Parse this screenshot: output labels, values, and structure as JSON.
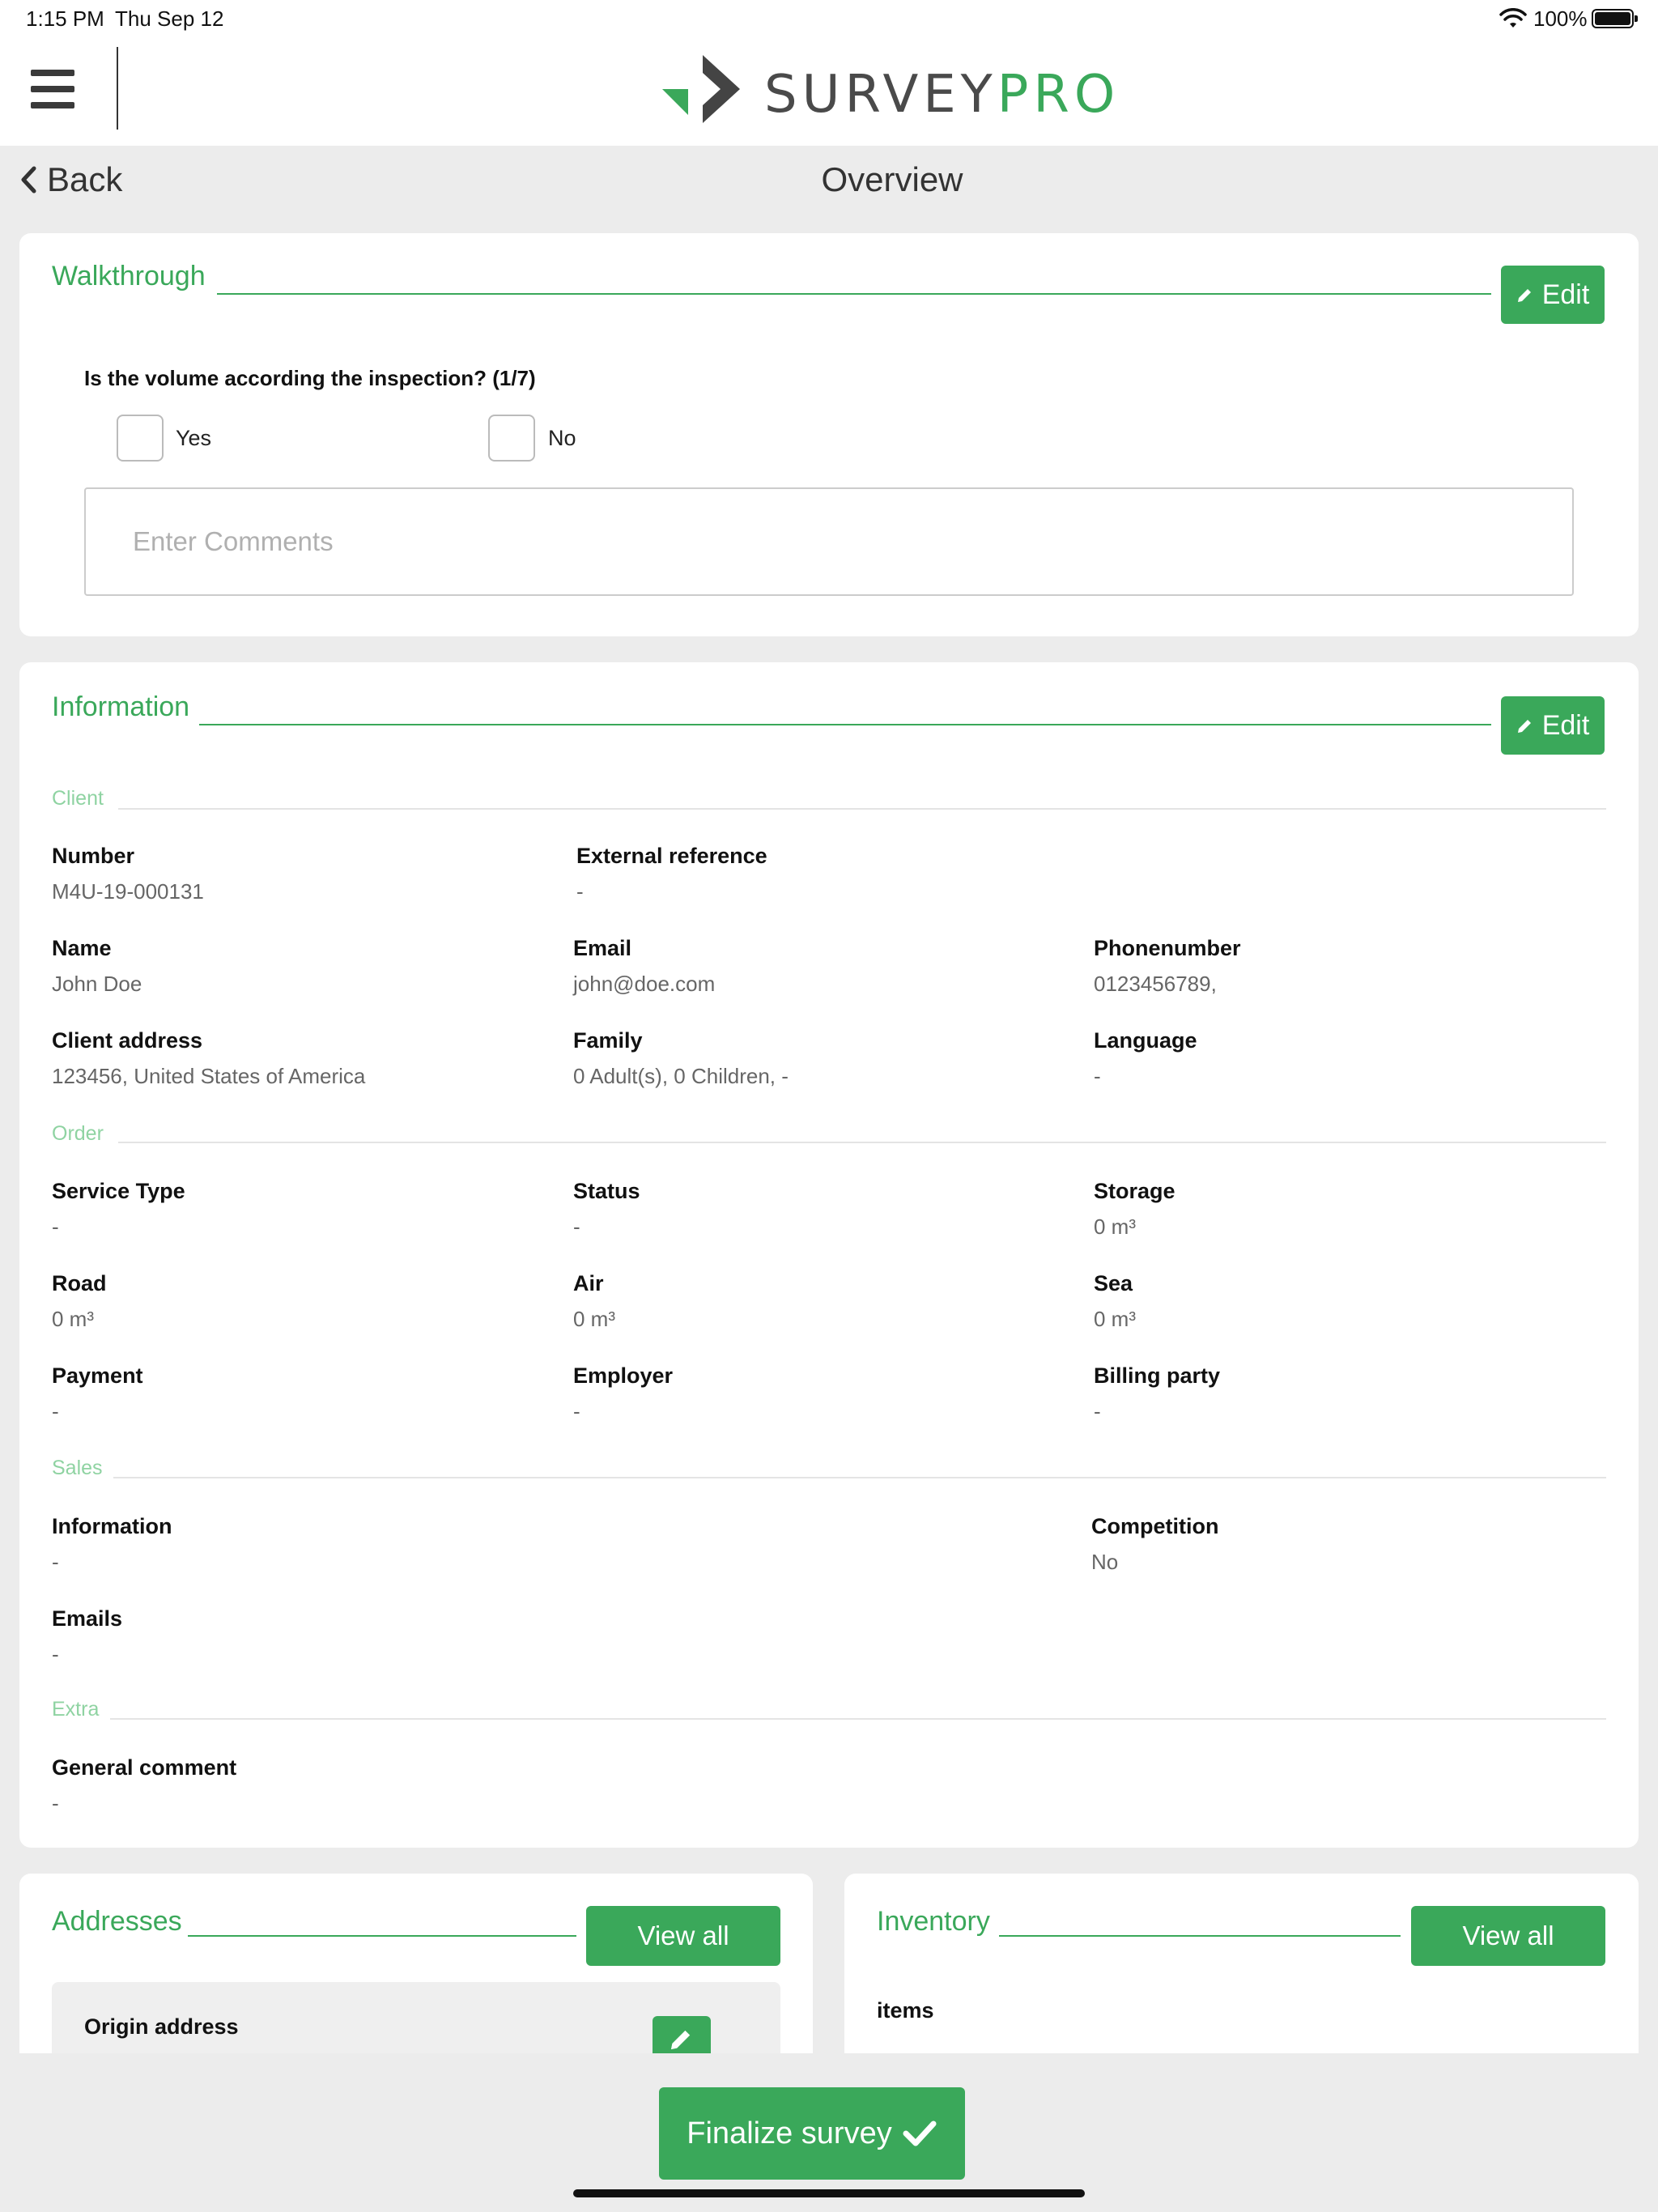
{
  "status_bar": {
    "time": "1:15 PM",
    "date": "Thu Sep 12",
    "battery": "100%"
  },
  "header": {
    "logo_part1": "SURVEY",
    "logo_part2": "PRO"
  },
  "nav": {
    "back_label": "Back",
    "title": "Overview"
  },
  "colors": {
    "accent": "#3aa85a",
    "accent_light": "#8fd3a2",
    "background": "#ececec"
  },
  "walkthrough": {
    "title": "Walkthrough",
    "edit_label": "Edit",
    "question": "Is the volume according the inspection? (1/7)",
    "options": [
      "Yes",
      "No"
    ],
    "comments_placeholder": "Enter Comments"
  },
  "information": {
    "title": "Information",
    "edit_label": "Edit",
    "sections": {
      "client": "Client",
      "order": "Order",
      "sales": "Sales",
      "extra": "Extra"
    },
    "fields": {
      "number": {
        "label": "Number",
        "value": "M4U-19-000131"
      },
      "external_reference": {
        "label": "External reference",
        "value": "-"
      },
      "name": {
        "label": "Name",
        "value": "John Doe"
      },
      "email": {
        "label": "Email",
        "value": "john@doe.com"
      },
      "phonenumber": {
        "label": "Phonenumber",
        "value": "0123456789,"
      },
      "client_address": {
        "label": "Client address",
        "value": "123456, United States of America"
      },
      "family": {
        "label": "Family",
        "value": "0 Adult(s), 0 Children, -"
      },
      "language": {
        "label": "Language",
        "value": "-"
      },
      "service_type": {
        "label": "Service Type",
        "value": "-"
      },
      "status": {
        "label": "Status",
        "value": "-"
      },
      "storage": {
        "label": "Storage",
        "value": "0 m³"
      },
      "road": {
        "label": "Road",
        "value": "0 m³"
      },
      "air": {
        "label": "Air",
        "value": "0 m³"
      },
      "sea": {
        "label": "Sea",
        "value": "0 m³"
      },
      "payment": {
        "label": "Payment",
        "value": "-"
      },
      "employer": {
        "label": "Employer",
        "value": "-"
      },
      "billing_party": {
        "label": "Billing party",
        "value": "-"
      },
      "sales_information": {
        "label": "Information",
        "value": "-"
      },
      "competition": {
        "label": "Competition",
        "value": "No"
      },
      "emails": {
        "label": "Emails",
        "value": "-"
      },
      "general_comment": {
        "label": "General comment",
        "value": "-"
      }
    }
  },
  "addresses": {
    "title": "Addresses",
    "view_all_label": "View all",
    "origin_label": "Origin address"
  },
  "inventory": {
    "title": "Inventory",
    "view_all_label": "View all",
    "items_label": "items"
  },
  "footer": {
    "finalize_label": "Finalize survey"
  }
}
